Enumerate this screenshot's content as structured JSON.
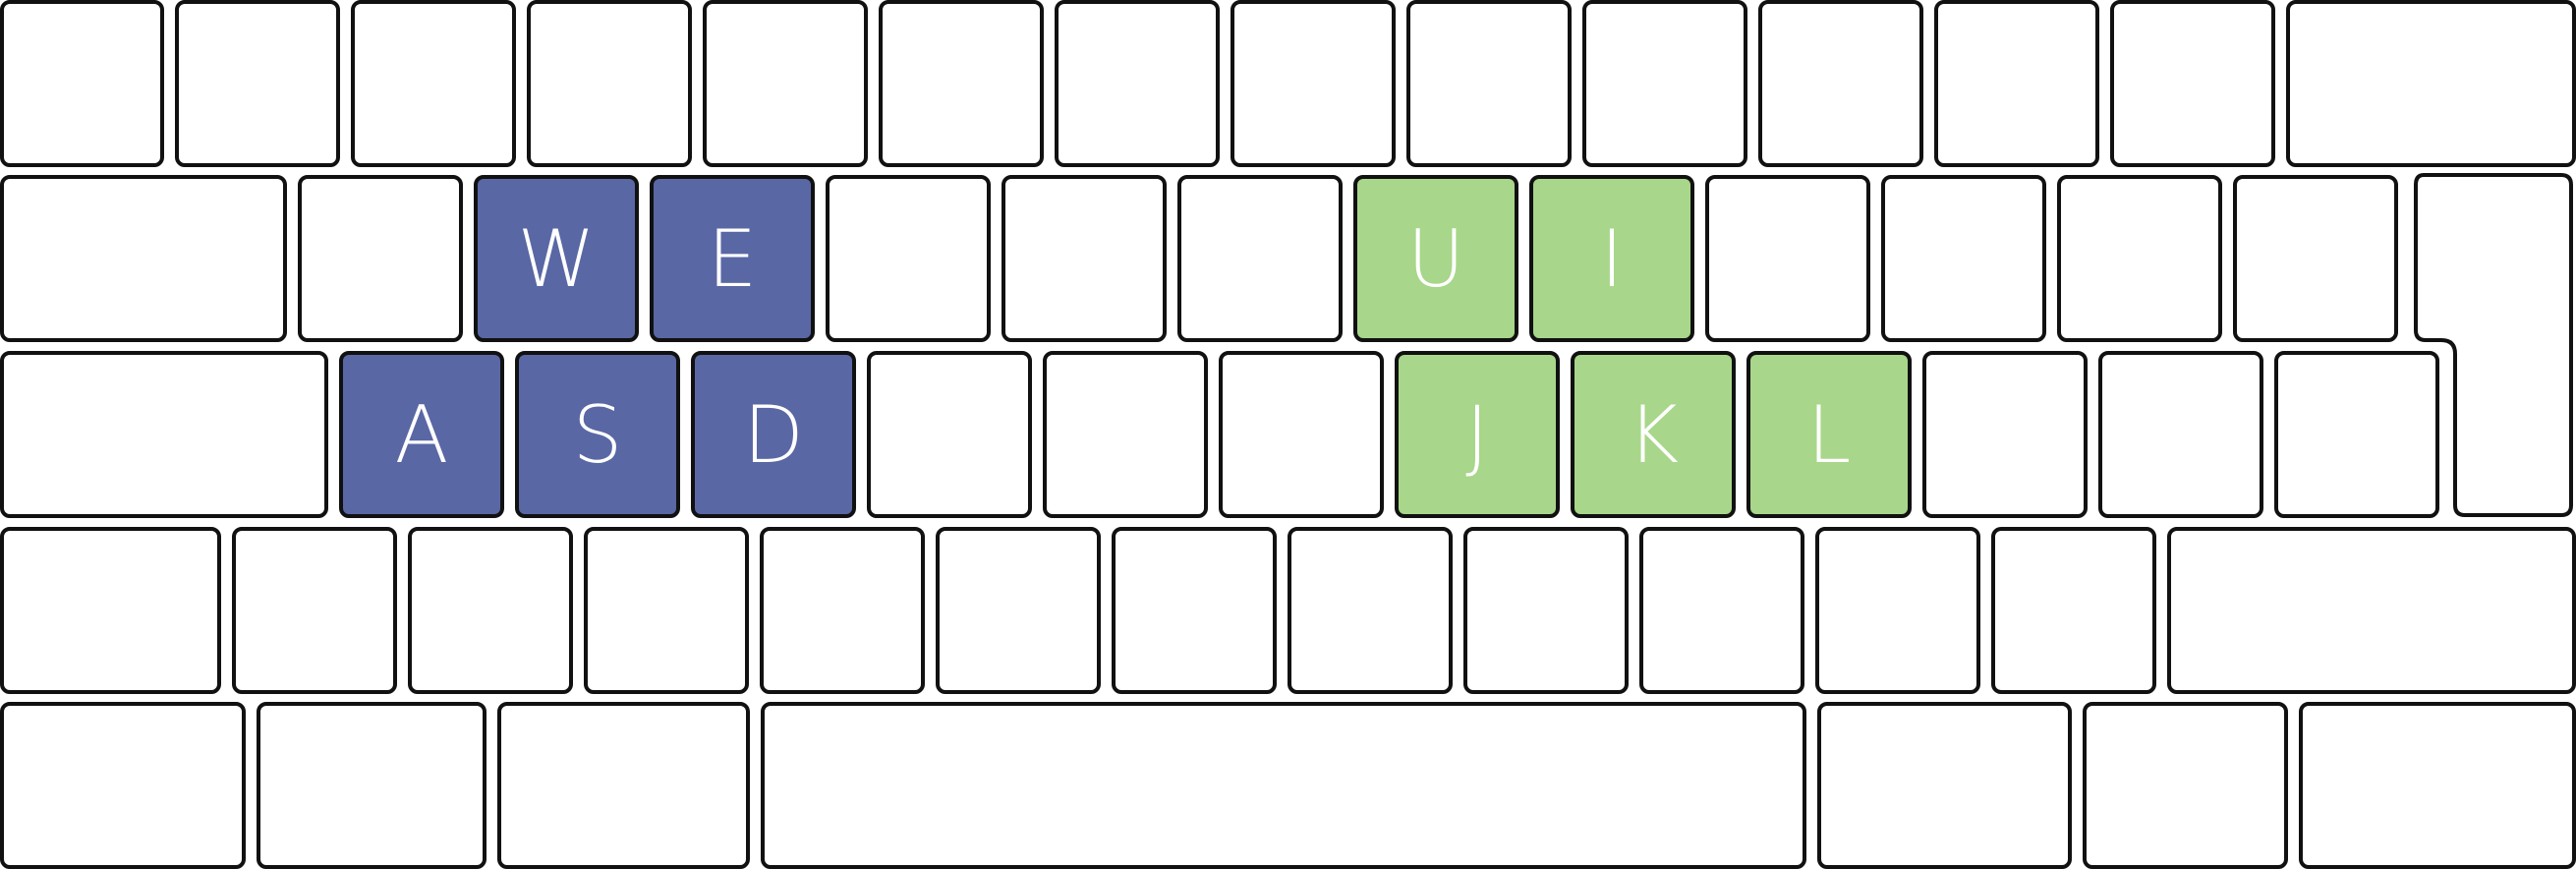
{
  "colors": {
    "left_hand": "#5a67a5",
    "right_hand": "#a8d68a",
    "key_fill": "#ffffff",
    "key_border": "#111111",
    "label": "#ffffff"
  },
  "rows": [
    [
      {
        "label": "",
        "group": ""
      },
      {
        "label": "",
        "group": ""
      },
      {
        "label": "",
        "group": ""
      },
      {
        "label": "",
        "group": ""
      },
      {
        "label": "",
        "group": ""
      },
      {
        "label": "",
        "group": ""
      },
      {
        "label": "",
        "group": ""
      },
      {
        "label": "",
        "group": ""
      },
      {
        "label": "",
        "group": ""
      },
      {
        "label": "",
        "group": ""
      },
      {
        "label": "",
        "group": ""
      },
      {
        "label": "",
        "group": ""
      },
      {
        "label": "",
        "group": ""
      },
      {
        "label": "",
        "group": ""
      }
    ],
    [
      {
        "label": "",
        "group": ""
      },
      {
        "label": "",
        "group": ""
      },
      {
        "label": "W",
        "group": "left"
      },
      {
        "label": "E",
        "group": "left"
      },
      {
        "label": "",
        "group": ""
      },
      {
        "label": "",
        "group": ""
      },
      {
        "label": "",
        "group": ""
      },
      {
        "label": "U",
        "group": "right"
      },
      {
        "label": "I",
        "group": "right"
      },
      {
        "label": "",
        "group": ""
      },
      {
        "label": "",
        "group": ""
      },
      {
        "label": "",
        "group": ""
      },
      {
        "label": "",
        "group": ""
      }
    ],
    [
      {
        "label": "",
        "group": ""
      },
      {
        "label": "A",
        "group": "left"
      },
      {
        "label": "S",
        "group": "left"
      },
      {
        "label": "D",
        "group": "left"
      },
      {
        "label": "",
        "group": ""
      },
      {
        "label": "",
        "group": ""
      },
      {
        "label": "",
        "group": ""
      },
      {
        "label": "J",
        "group": "right"
      },
      {
        "label": "K",
        "group": "right"
      },
      {
        "label": "L",
        "group": "right"
      },
      {
        "label": "",
        "group": ""
      },
      {
        "label": "",
        "group": ""
      },
      {
        "label": "",
        "group": ""
      }
    ],
    [
      {
        "label": "",
        "group": ""
      },
      {
        "label": "",
        "group": ""
      },
      {
        "label": "",
        "group": ""
      },
      {
        "label": "",
        "group": ""
      },
      {
        "label": "",
        "group": ""
      },
      {
        "label": "",
        "group": ""
      },
      {
        "label": "",
        "group": ""
      },
      {
        "label": "",
        "group": ""
      },
      {
        "label": "",
        "group": ""
      },
      {
        "label": "",
        "group": ""
      },
      {
        "label": "",
        "group": ""
      },
      {
        "label": "",
        "group": ""
      },
      {
        "label": "",
        "group": ""
      }
    ],
    [
      {
        "label": "",
        "group": ""
      },
      {
        "label": "",
        "group": ""
      },
      {
        "label": "",
        "group": ""
      },
      {
        "label": "",
        "group": ""
      },
      {
        "label": "",
        "group": ""
      },
      {
        "label": "",
        "group": ""
      },
      {
        "label": "",
        "group": ""
      }
    ]
  ]
}
